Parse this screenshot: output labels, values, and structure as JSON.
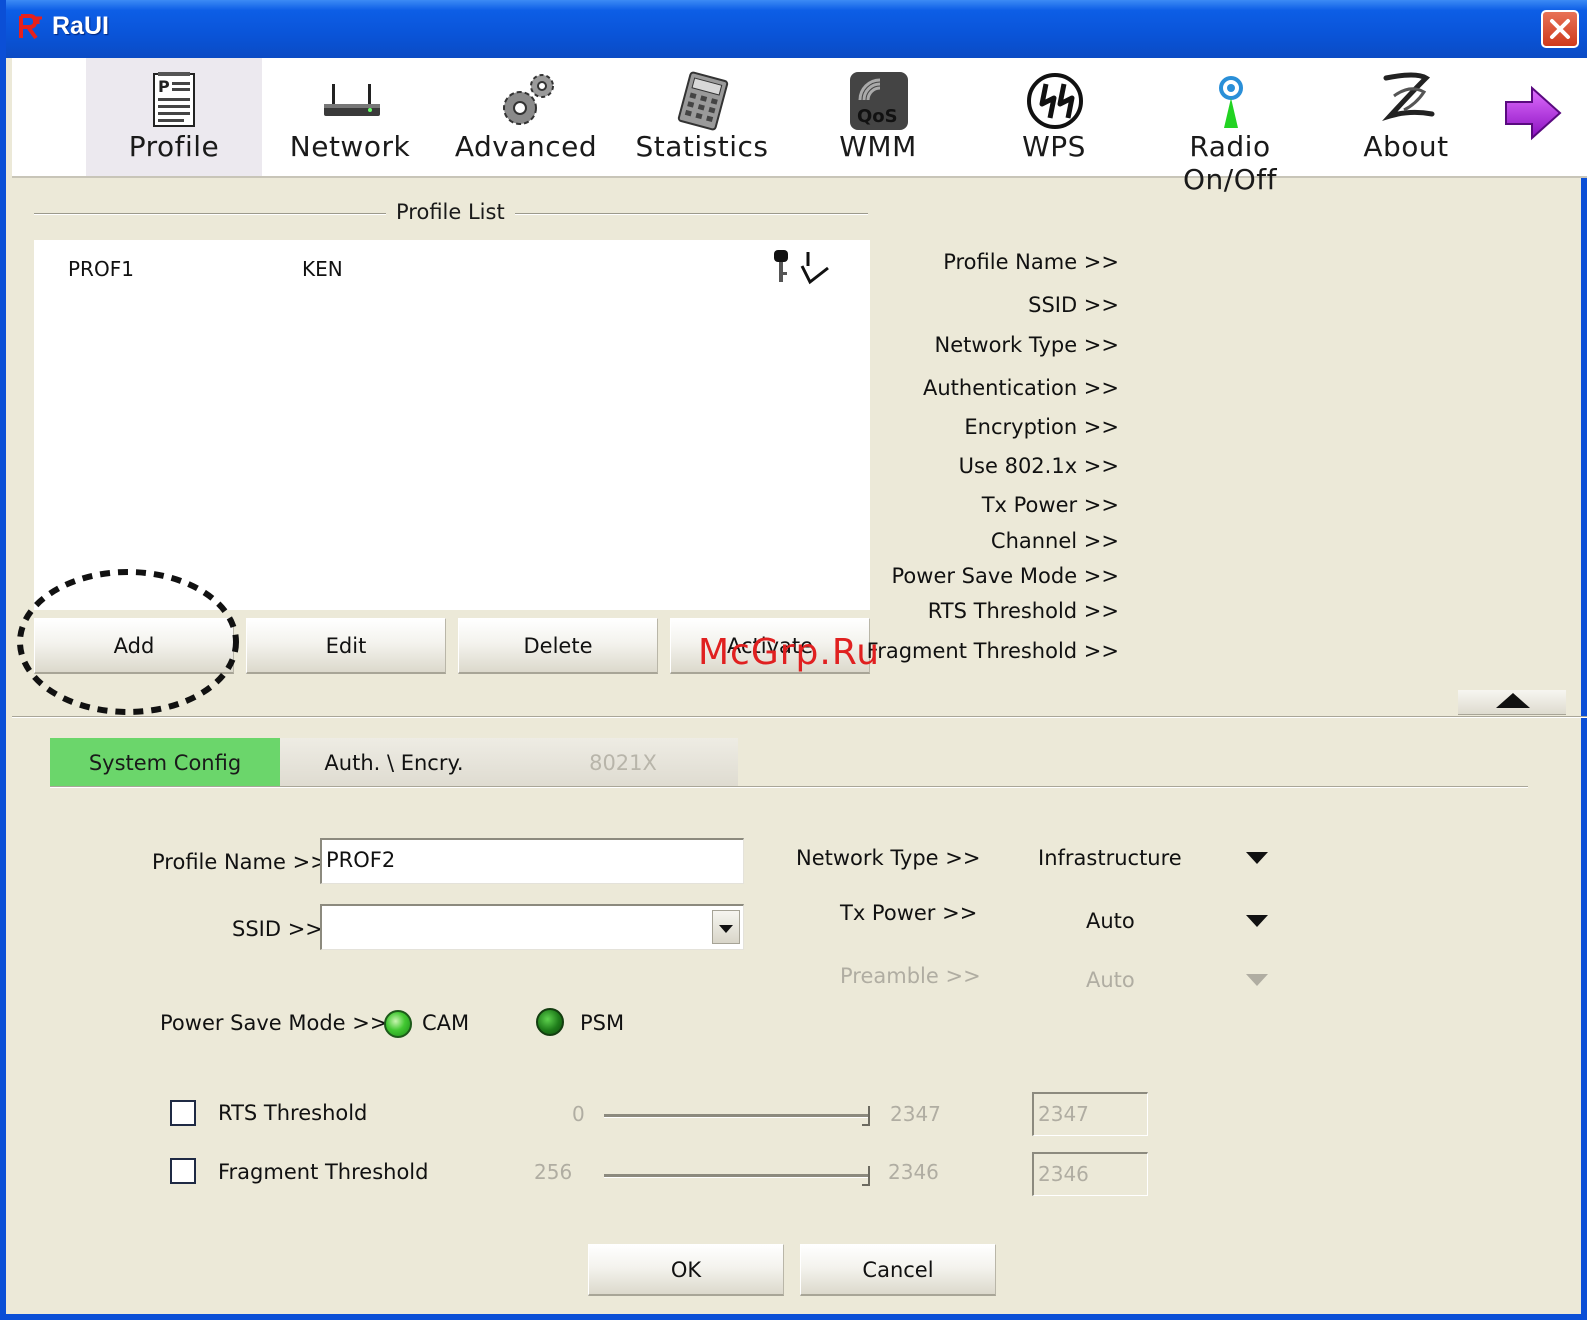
{
  "window": {
    "title": "RaUI"
  },
  "toolbar": {
    "items": [
      {
        "label": "Profile",
        "icon": "profile-icon",
        "active": true
      },
      {
        "label": "Network",
        "icon": "network-icon"
      },
      {
        "label": "Advanced",
        "icon": "advanced-gears-icon"
      },
      {
        "label": "Statistics",
        "icon": "statistics-calculator-icon"
      },
      {
        "label": "WMM",
        "icon": "qos-icon"
      },
      {
        "label": "WPS",
        "icon": "wps-icon"
      },
      {
        "label": "Radio On/Off",
        "icon": "radio-antenna-icon"
      },
      {
        "label": "About",
        "icon": "about-icon"
      }
    ],
    "next_icon": "next-arrow-icon"
  },
  "profile_list": {
    "title": "Profile List",
    "rows": [
      {
        "name": "PROF1",
        "ssid": "KEN",
        "icons": [
          "key-icon",
          "connected-check-icon"
        ]
      }
    ],
    "buttons": {
      "add": "Add",
      "edit": "Edit",
      "delete": "Delete",
      "activate": "Activate"
    }
  },
  "details": {
    "labels": [
      "Profile Name >>",
      "SSID >>",
      "Network Type >>",
      "Authentication >>",
      "Encryption >>",
      "Use 802.1x >>",
      "Tx Power >>",
      "Channel >>",
      "Power Save Mode >>",
      "RTS Threshold >>",
      "Fragment Threshold >>"
    ]
  },
  "watermark": "McGrp.Ru",
  "tabs": [
    {
      "label": "System Config",
      "state": "active"
    },
    {
      "label": "Auth. \\ Encry.",
      "state": "normal"
    },
    {
      "label": "8021X",
      "state": "disabled"
    }
  ],
  "system_config": {
    "profile_name": {
      "label": "Profile Name >>",
      "value": "PROF2"
    },
    "ssid": {
      "label": "SSID >>",
      "value": ""
    },
    "network_type": {
      "label": "Network Type >>",
      "value": "Infrastructure"
    },
    "tx_power": {
      "label": "Tx Power >>",
      "value": "Auto"
    },
    "preamble": {
      "label": "Preamble >>",
      "value": "Auto"
    },
    "power_save": {
      "label": "Power Save Mode >>",
      "options": [
        "CAM",
        "PSM"
      ],
      "selected": "CAM"
    },
    "rts": {
      "label": "RTS Threshold",
      "min": "0",
      "max": "2347",
      "value": "2347",
      "checked": false
    },
    "fragment": {
      "label": "Fragment Threshold",
      "min": "256",
      "max": "2346",
      "value": "2346",
      "checked": false
    }
  },
  "footer": {
    "ok": "OK",
    "cancel": "Cancel"
  },
  "colors": {
    "titlebar": "#0a54d8",
    "active_tab": "#6bd66b",
    "watermark": "#e02020",
    "window_bg": "#ece9d8"
  }
}
